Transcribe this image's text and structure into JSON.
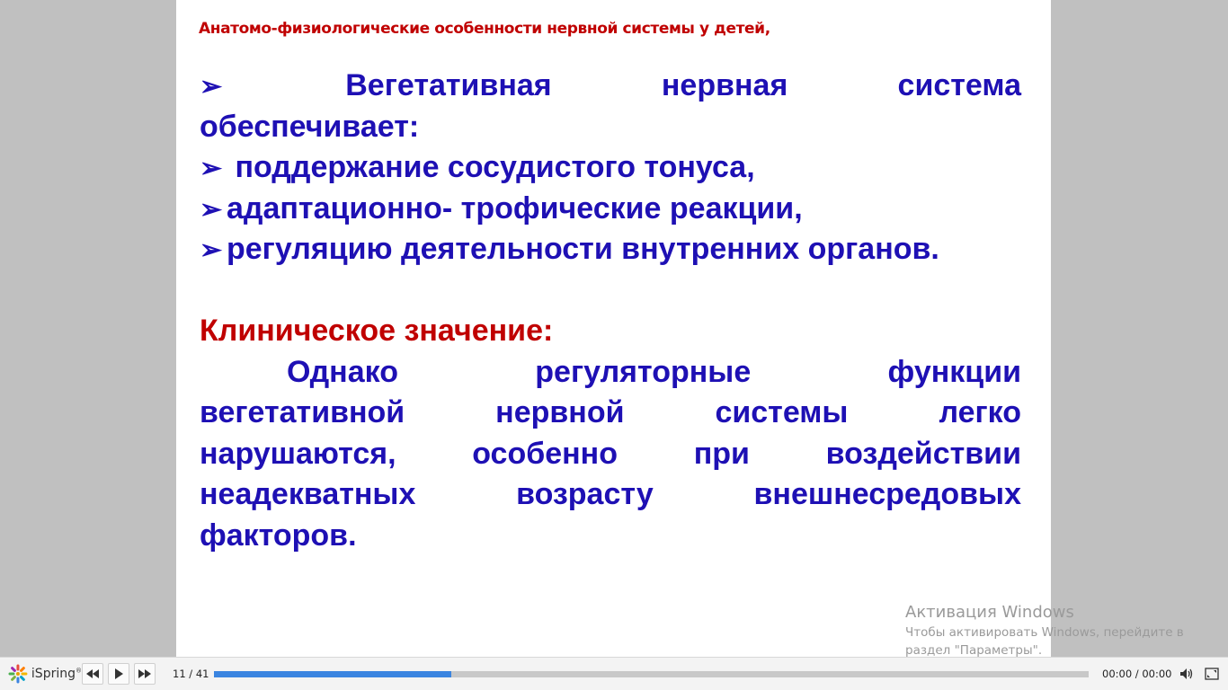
{
  "slide": {
    "header": "Анатомо-физиологические особенности нервной системы у детей,",
    "bullet_glyph": "➢",
    "line1_words": [
      "Вегетативная",
      "нервная",
      "система"
    ],
    "line2": "обеспечивает:",
    "bullets": [
      " поддержание сосудистого тонуса,",
      "адаптационно- трофические реакции,",
      "регуляцию деятельности внутренних органов."
    ],
    "clinical_label_1": "Клиническое",
    "clinical_label_2": " значение:",
    "paragraph_lines": [
      [
        "Однако",
        "регуляторные",
        "функции"
      ],
      [
        "вегетативной",
        "нервной",
        "системы",
        "легко"
      ],
      [
        "нарушаются,",
        "особенно",
        "при",
        "воздействии"
      ],
      [
        "неадекватных",
        "возрасту",
        "внешнесредовых"
      ]
    ],
    "paragraph_last": "факторов."
  },
  "watermark": {
    "title": "Активация Windows",
    "line1": "Чтобы активировать Windows, перейдите в",
    "line2": "раздел \"Параметры\"."
  },
  "player": {
    "brand": "iSpring",
    "brand_mark": "®",
    "slide_counter": "11 / 41",
    "progress_fraction": 0.271,
    "time": "00:00 / 00:00",
    "colors": {
      "progress": "#3a84e0",
      "slide_text": "#1e10b4",
      "accent_red": "#c00000"
    }
  }
}
